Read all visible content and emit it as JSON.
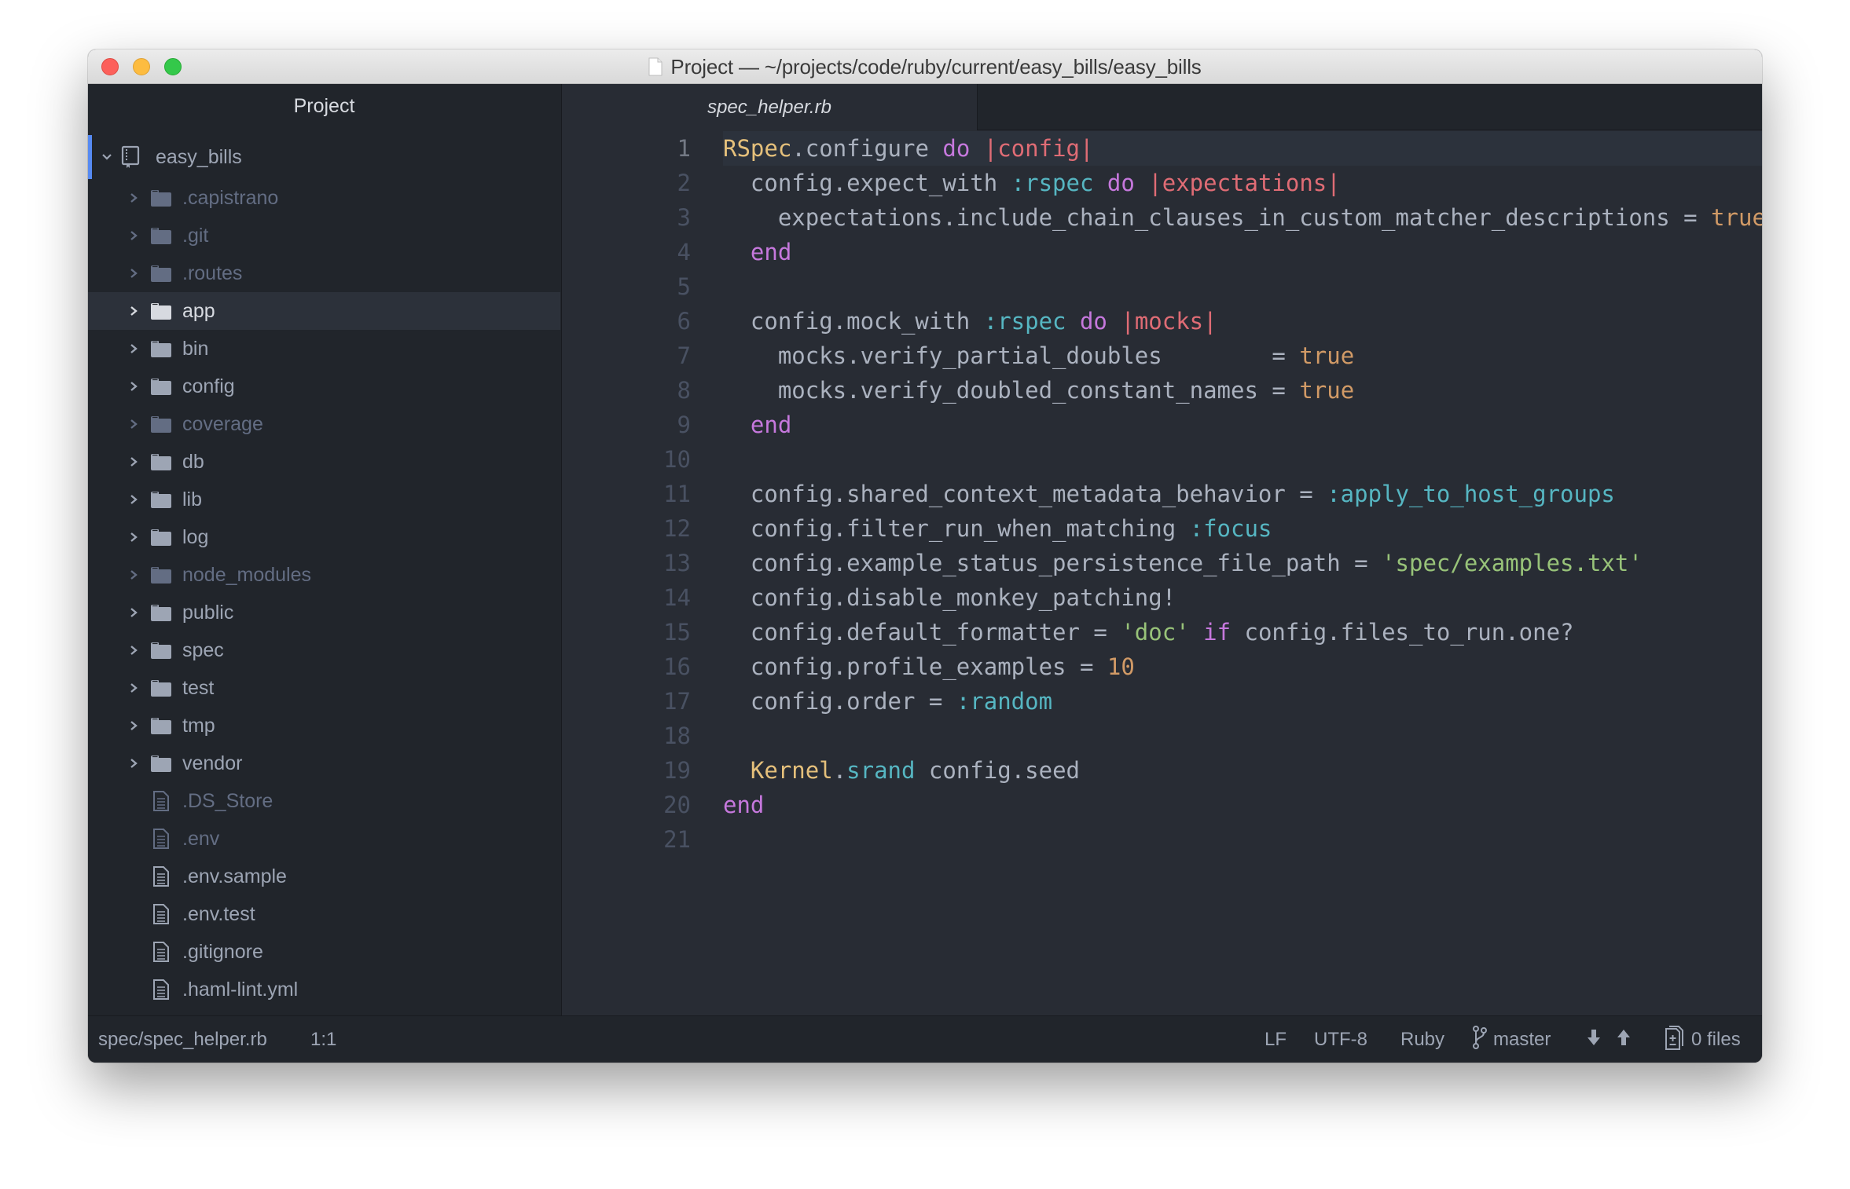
{
  "window": {
    "title": "Project — ~/projects/code/ruby/current/easy_bills/easy_bills",
    "traffic_lights": {
      "close": "#fc605b",
      "minimize": "#fdbc40",
      "maximize": "#34c84a"
    }
  },
  "sidebar": {
    "header": "Project",
    "root": {
      "label": "easy_bills",
      "icon": "repo-icon",
      "expanded": true
    },
    "items": [
      {
        "label": ".capistrano",
        "type": "folder",
        "ignored": true
      },
      {
        "label": ".git",
        "type": "folder",
        "ignored": true
      },
      {
        "label": ".routes",
        "type": "folder",
        "ignored": true
      },
      {
        "label": "app",
        "type": "folder",
        "selected": true
      },
      {
        "label": "bin",
        "type": "folder"
      },
      {
        "label": "config",
        "type": "folder"
      },
      {
        "label": "coverage",
        "type": "folder",
        "ignored": true
      },
      {
        "label": "db",
        "type": "folder"
      },
      {
        "label": "lib",
        "type": "folder"
      },
      {
        "label": "log",
        "type": "folder"
      },
      {
        "label": "node_modules",
        "type": "folder",
        "ignored": true
      },
      {
        "label": "public",
        "type": "folder"
      },
      {
        "label": "spec",
        "type": "folder"
      },
      {
        "label": "test",
        "type": "folder"
      },
      {
        "label": "tmp",
        "type": "folder"
      },
      {
        "label": "vendor",
        "type": "folder"
      },
      {
        "label": ".DS_Store",
        "type": "file",
        "ignored": true
      },
      {
        "label": ".env",
        "type": "file",
        "ignored": true
      },
      {
        "label": ".env.sample",
        "type": "file"
      },
      {
        "label": ".env.test",
        "type": "file"
      },
      {
        "label": ".gitignore",
        "type": "file"
      },
      {
        "label": ".haml-lint.yml",
        "type": "file"
      }
    ]
  },
  "editor": {
    "tabs": [
      {
        "label": "spec_helper.rb",
        "active": true
      }
    ],
    "cursor_line": 1,
    "lines": [
      [
        [
          "const",
          "RSpec"
        ],
        [
          "plain",
          ".configure "
        ],
        [
          "kw",
          "do"
        ],
        [
          "plain",
          " "
        ],
        [
          "var",
          "|config|"
        ]
      ],
      [
        [
          "plain",
          "  config.expect_with "
        ],
        [
          "sym",
          ":rspec"
        ],
        [
          "plain",
          " "
        ],
        [
          "kw",
          "do"
        ],
        [
          "plain",
          " "
        ],
        [
          "var",
          "|expectations|"
        ]
      ],
      [
        [
          "plain",
          "    expectations.include_chain_clauses_in_custom_matcher_descriptions = "
        ],
        [
          "num",
          "true"
        ]
      ],
      [
        [
          "plain",
          "  "
        ],
        [
          "kw",
          "end"
        ]
      ],
      [],
      [
        [
          "plain",
          "  config.mock_with "
        ],
        [
          "sym",
          ":rspec"
        ],
        [
          "plain",
          " "
        ],
        [
          "kw",
          "do"
        ],
        [
          "plain",
          " "
        ],
        [
          "var",
          "|mocks|"
        ]
      ],
      [
        [
          "plain",
          "    mocks.verify_partial_doubles        = "
        ],
        [
          "num",
          "true"
        ]
      ],
      [
        [
          "plain",
          "    mocks.verify_doubled_constant_names = "
        ],
        [
          "num",
          "true"
        ]
      ],
      [
        [
          "plain",
          "  "
        ],
        [
          "kw",
          "end"
        ]
      ],
      [],
      [
        [
          "plain",
          "  config.shared_context_metadata_behavior = "
        ],
        [
          "sym",
          ":apply_to_host_groups"
        ]
      ],
      [
        [
          "plain",
          "  config.filter_run_when_matching "
        ],
        [
          "sym",
          ":focus"
        ]
      ],
      [
        [
          "plain",
          "  config.example_status_persistence_file_path = "
        ],
        [
          "str",
          "'spec/examples.txt'"
        ]
      ],
      [
        [
          "plain",
          "  config.disable_monkey_patching!"
        ]
      ],
      [
        [
          "plain",
          "  config.default_formatter = "
        ],
        [
          "str",
          "'doc'"
        ],
        [
          "plain",
          " "
        ],
        [
          "kw",
          "if"
        ],
        [
          "plain",
          " config.files_to_run.one?"
        ]
      ],
      [
        [
          "plain",
          "  config.profile_examples = "
        ],
        [
          "num",
          "10"
        ]
      ],
      [
        [
          "plain",
          "  config.order = "
        ],
        [
          "sym",
          ":random"
        ]
      ],
      [],
      [
        [
          "plain",
          "  "
        ],
        [
          "const",
          "Kernel"
        ],
        [
          "plain",
          "."
        ],
        [
          "fn",
          "srand"
        ],
        [
          "plain",
          " config.seed"
        ]
      ],
      [
        [
          "kw",
          "end"
        ]
      ],
      []
    ]
  },
  "status_bar": {
    "file_path": "spec/spec_helper.rb",
    "cursor_position": "1:1",
    "line_ending": "LF",
    "encoding": "UTF-8",
    "grammar": "Ruby",
    "branch": "master",
    "fetch_icon": "arrow-down-icon",
    "push_icon": "arrow-up-icon",
    "changed_files": "0 files"
  },
  "colors": {
    "accent": "#568af2",
    "editor_bg": "#282c34",
    "panel_bg": "#21252b"
  }
}
